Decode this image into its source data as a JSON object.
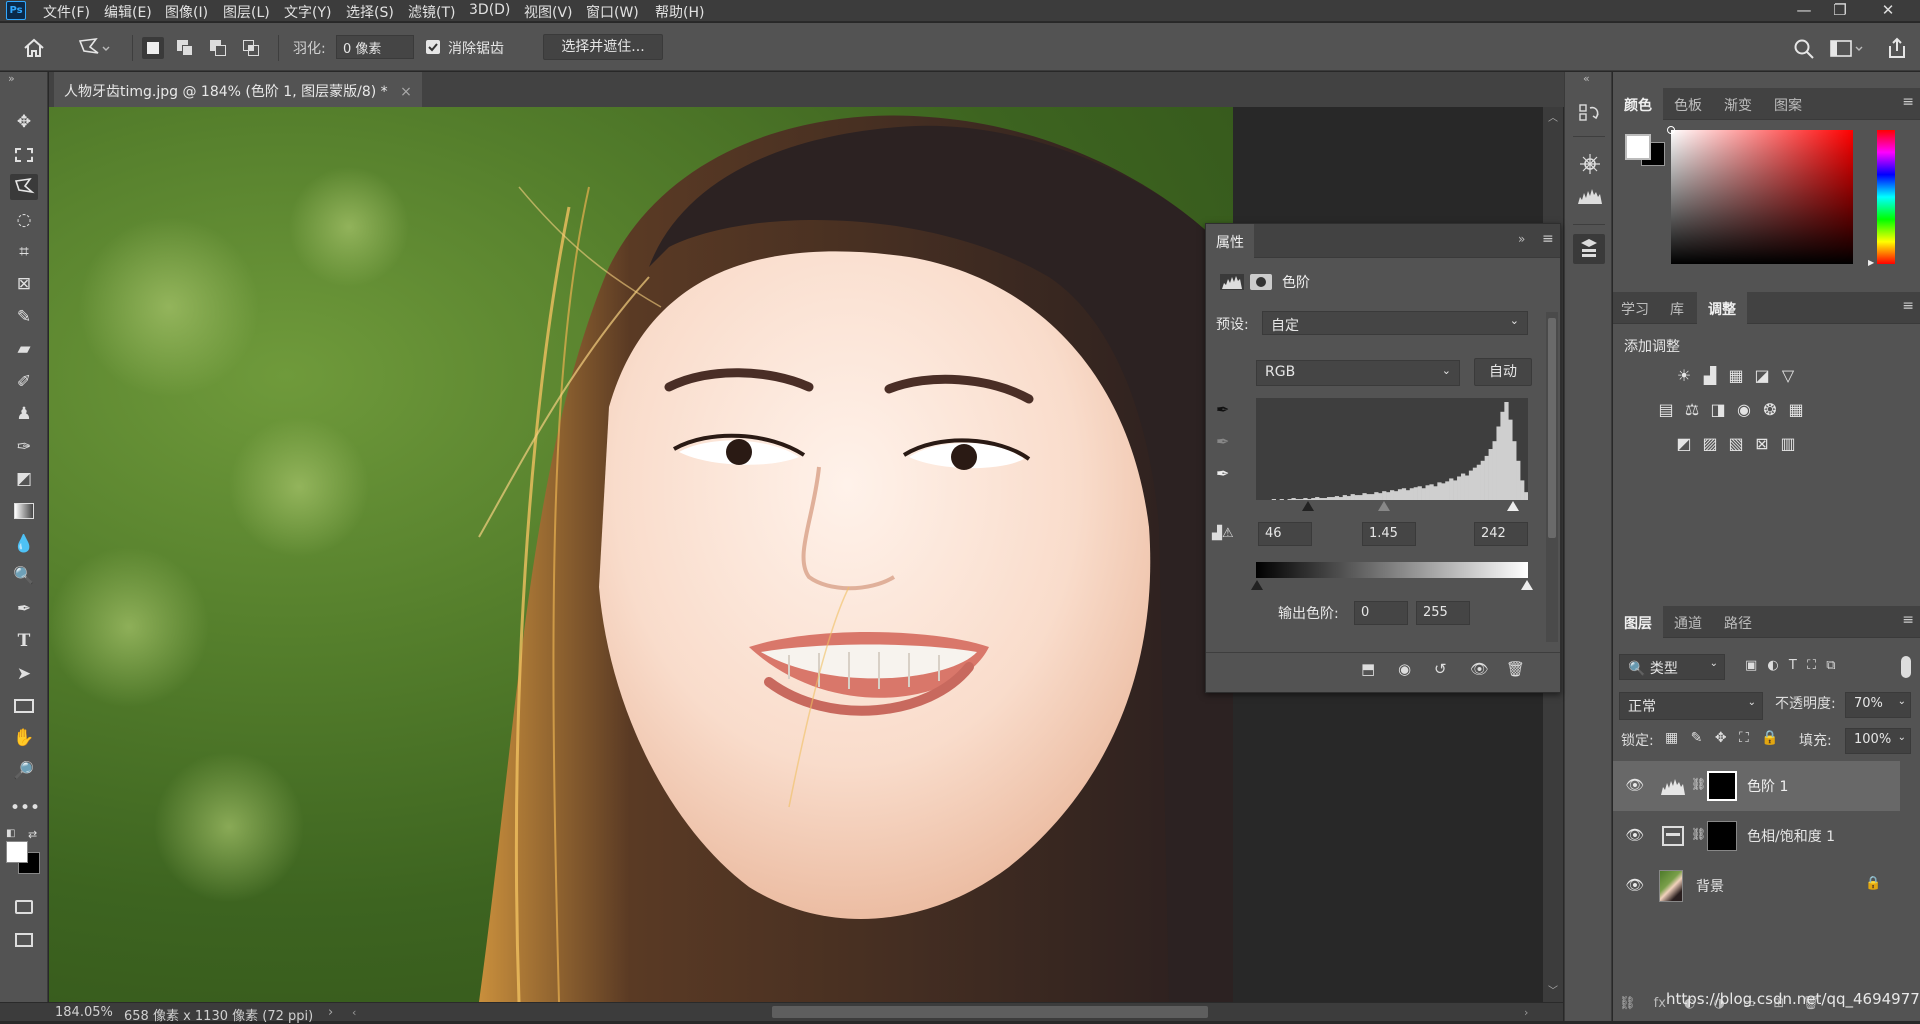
{
  "menubar": {
    "logo": "Ps",
    "items": [
      "文件(F)",
      "编辑(E)",
      "图像(I)",
      "图层(L)",
      "文字(Y)",
      "选择(S)",
      "滤镜(T)",
      "3D(D)",
      "视图(V)",
      "窗口(W)",
      "帮助(H)"
    ],
    "minimize": "—",
    "restore": "❐",
    "close": "✕"
  },
  "options": {
    "feather_label": "羽化:",
    "feather_value": "0 像素",
    "antialias_label": "消除锯齿",
    "antialias_checked": true,
    "select_mask_button": "选择并遮住..."
  },
  "document": {
    "tab_title": "人物牙齿timg.jpg @ 184% (色阶 1, 图层蒙版/8) *",
    "tab_close": "×"
  },
  "status": {
    "zoom": "184.05%",
    "size": "658 像素 x 1130 像素 (72 ppi)",
    "arrow": "›"
  },
  "color_panel": {
    "tabs": [
      "颜色",
      "色板",
      "渐变",
      "图案"
    ],
    "active_tab": "颜色",
    "foreground": "#ffffff",
    "background": "#000000"
  },
  "adjust_panel": {
    "tabs": [
      "学习",
      "库",
      "调整"
    ],
    "active_tab": "调整",
    "title": "添加调整",
    "icons_row1": [
      "brightness-contrast-icon",
      "levels-icon",
      "curves-icon",
      "exposure-icon",
      "vibrance-icon"
    ],
    "icons_row2": [
      "hue-saturation-icon",
      "color-balance-icon",
      "black-white-icon",
      "photo-filter-icon",
      "channel-mixer-icon",
      "color-lookup-icon"
    ],
    "icons_row3": [
      "invert-icon",
      "posterize-icon",
      "threshold-icon",
      "selective-color-icon",
      "gradient-map-icon"
    ]
  },
  "layers_panel": {
    "tabs": [
      "图层",
      "通道",
      "路径"
    ],
    "active_tab": "图层",
    "filter_kind": "类型",
    "blend_mode": "正常",
    "opacity_label": "不透明度:",
    "opacity_value": "70%",
    "lock_label": "锁定:",
    "fill_label": "填充:",
    "fill_value": "100%",
    "layers": [
      {
        "name": "色阶 1",
        "type": "levels-adjustment",
        "selected": true,
        "visible": true
      },
      {
        "name": "色相/饱和度 1",
        "type": "hue-saturation-adjustment",
        "selected": false,
        "visible": true
      },
      {
        "name": "背景",
        "type": "image",
        "selected": false,
        "visible": true,
        "locked": true
      }
    ]
  },
  "properties_panel": {
    "tab": "属性",
    "adjustment_name": "色阶",
    "preset_label": "预设:",
    "preset_value": "自定",
    "channel": "RGB",
    "auto_button": "自动",
    "input_black": "46",
    "input_gamma": "1.45",
    "input_white": "242",
    "output_label": "输出色阶:",
    "output_black": "0",
    "output_white": "255",
    "histogram": [
      0,
      0,
      0,
      0,
      1,
      0,
      1,
      0,
      1,
      2,
      1,
      1,
      2,
      1,
      2,
      3,
      2,
      2,
      3,
      3,
      4,
      3,
      5,
      4,
      6,
      5,
      5,
      7,
      6,
      6,
      8,
      7,
      9,
      8,
      10,
      9,
      11,
      12,
      10,
      12,
      13,
      14,
      12,
      15,
      16,
      14,
      18,
      17,
      19,
      22,
      20,
      24,
      27,
      25,
      30,
      33,
      36,
      40,
      45,
      52,
      60,
      75,
      90,
      100,
      82,
      60,
      40,
      20,
      8
    ]
  },
  "watermark": "https://blog.csdn.net/qq_46949773"
}
